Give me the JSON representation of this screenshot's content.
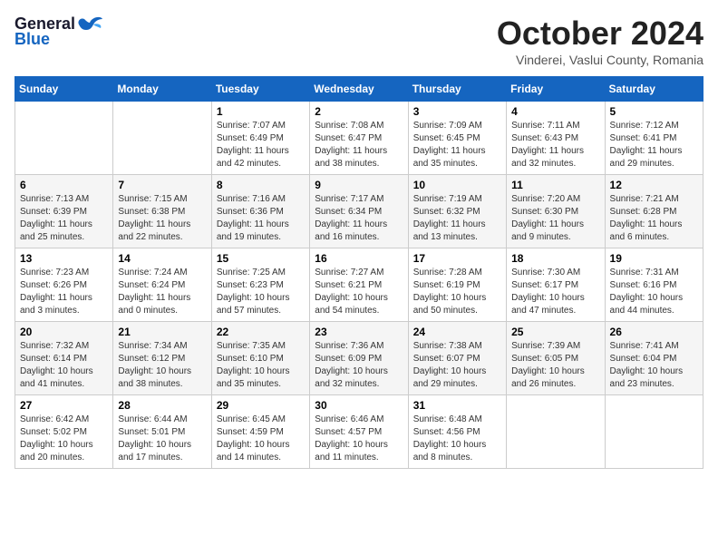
{
  "logo": {
    "general": "General",
    "blue": "Blue"
  },
  "title": "October 2024",
  "subtitle": "Vinderei, Vaslui County, Romania",
  "days_of_week": [
    "Sunday",
    "Monday",
    "Tuesday",
    "Wednesday",
    "Thursday",
    "Friday",
    "Saturday"
  ],
  "weeks": [
    [
      {
        "day": "",
        "info": ""
      },
      {
        "day": "",
        "info": ""
      },
      {
        "day": "1",
        "sunrise": "Sunrise: 7:07 AM",
        "sunset": "Sunset: 6:49 PM",
        "daylight": "Daylight: 11 hours and 42 minutes."
      },
      {
        "day": "2",
        "sunrise": "Sunrise: 7:08 AM",
        "sunset": "Sunset: 6:47 PM",
        "daylight": "Daylight: 11 hours and 38 minutes."
      },
      {
        "day": "3",
        "sunrise": "Sunrise: 7:09 AM",
        "sunset": "Sunset: 6:45 PM",
        "daylight": "Daylight: 11 hours and 35 minutes."
      },
      {
        "day": "4",
        "sunrise": "Sunrise: 7:11 AM",
        "sunset": "Sunset: 6:43 PM",
        "daylight": "Daylight: 11 hours and 32 minutes."
      },
      {
        "day": "5",
        "sunrise": "Sunrise: 7:12 AM",
        "sunset": "Sunset: 6:41 PM",
        "daylight": "Daylight: 11 hours and 29 minutes."
      }
    ],
    [
      {
        "day": "6",
        "sunrise": "Sunrise: 7:13 AM",
        "sunset": "Sunset: 6:39 PM",
        "daylight": "Daylight: 11 hours and 25 minutes."
      },
      {
        "day": "7",
        "sunrise": "Sunrise: 7:15 AM",
        "sunset": "Sunset: 6:38 PM",
        "daylight": "Daylight: 11 hours and 22 minutes."
      },
      {
        "day": "8",
        "sunrise": "Sunrise: 7:16 AM",
        "sunset": "Sunset: 6:36 PM",
        "daylight": "Daylight: 11 hours and 19 minutes."
      },
      {
        "day": "9",
        "sunrise": "Sunrise: 7:17 AM",
        "sunset": "Sunset: 6:34 PM",
        "daylight": "Daylight: 11 hours and 16 minutes."
      },
      {
        "day": "10",
        "sunrise": "Sunrise: 7:19 AM",
        "sunset": "Sunset: 6:32 PM",
        "daylight": "Daylight: 11 hours and 13 minutes."
      },
      {
        "day": "11",
        "sunrise": "Sunrise: 7:20 AM",
        "sunset": "Sunset: 6:30 PM",
        "daylight": "Daylight: 11 hours and 9 minutes."
      },
      {
        "day": "12",
        "sunrise": "Sunrise: 7:21 AM",
        "sunset": "Sunset: 6:28 PM",
        "daylight": "Daylight: 11 hours and 6 minutes."
      }
    ],
    [
      {
        "day": "13",
        "sunrise": "Sunrise: 7:23 AM",
        "sunset": "Sunset: 6:26 PM",
        "daylight": "Daylight: 11 hours and 3 minutes."
      },
      {
        "day": "14",
        "sunrise": "Sunrise: 7:24 AM",
        "sunset": "Sunset: 6:24 PM",
        "daylight": "Daylight: 11 hours and 0 minutes."
      },
      {
        "day": "15",
        "sunrise": "Sunrise: 7:25 AM",
        "sunset": "Sunset: 6:23 PM",
        "daylight": "Daylight: 10 hours and 57 minutes."
      },
      {
        "day": "16",
        "sunrise": "Sunrise: 7:27 AM",
        "sunset": "Sunset: 6:21 PM",
        "daylight": "Daylight: 10 hours and 54 minutes."
      },
      {
        "day": "17",
        "sunrise": "Sunrise: 7:28 AM",
        "sunset": "Sunset: 6:19 PM",
        "daylight": "Daylight: 10 hours and 50 minutes."
      },
      {
        "day": "18",
        "sunrise": "Sunrise: 7:30 AM",
        "sunset": "Sunset: 6:17 PM",
        "daylight": "Daylight: 10 hours and 47 minutes."
      },
      {
        "day": "19",
        "sunrise": "Sunrise: 7:31 AM",
        "sunset": "Sunset: 6:16 PM",
        "daylight": "Daylight: 10 hours and 44 minutes."
      }
    ],
    [
      {
        "day": "20",
        "sunrise": "Sunrise: 7:32 AM",
        "sunset": "Sunset: 6:14 PM",
        "daylight": "Daylight: 10 hours and 41 minutes."
      },
      {
        "day": "21",
        "sunrise": "Sunrise: 7:34 AM",
        "sunset": "Sunset: 6:12 PM",
        "daylight": "Daylight: 10 hours and 38 minutes."
      },
      {
        "day": "22",
        "sunrise": "Sunrise: 7:35 AM",
        "sunset": "Sunset: 6:10 PM",
        "daylight": "Daylight: 10 hours and 35 minutes."
      },
      {
        "day": "23",
        "sunrise": "Sunrise: 7:36 AM",
        "sunset": "Sunset: 6:09 PM",
        "daylight": "Daylight: 10 hours and 32 minutes."
      },
      {
        "day": "24",
        "sunrise": "Sunrise: 7:38 AM",
        "sunset": "Sunset: 6:07 PM",
        "daylight": "Daylight: 10 hours and 29 minutes."
      },
      {
        "day": "25",
        "sunrise": "Sunrise: 7:39 AM",
        "sunset": "Sunset: 6:05 PM",
        "daylight": "Daylight: 10 hours and 26 minutes."
      },
      {
        "day": "26",
        "sunrise": "Sunrise: 7:41 AM",
        "sunset": "Sunset: 6:04 PM",
        "daylight": "Daylight: 10 hours and 23 minutes."
      }
    ],
    [
      {
        "day": "27",
        "sunrise": "Sunrise: 6:42 AM",
        "sunset": "Sunset: 5:02 PM",
        "daylight": "Daylight: 10 hours and 20 minutes."
      },
      {
        "day": "28",
        "sunrise": "Sunrise: 6:44 AM",
        "sunset": "Sunset: 5:01 PM",
        "daylight": "Daylight: 10 hours and 17 minutes."
      },
      {
        "day": "29",
        "sunrise": "Sunrise: 6:45 AM",
        "sunset": "Sunset: 4:59 PM",
        "daylight": "Daylight: 10 hours and 14 minutes."
      },
      {
        "day": "30",
        "sunrise": "Sunrise: 6:46 AM",
        "sunset": "Sunset: 4:57 PM",
        "daylight": "Daylight: 10 hours and 11 minutes."
      },
      {
        "day": "31",
        "sunrise": "Sunrise: 6:48 AM",
        "sunset": "Sunset: 4:56 PM",
        "daylight": "Daylight: 10 hours and 8 minutes."
      },
      {
        "day": "",
        "info": ""
      },
      {
        "day": "",
        "info": ""
      }
    ]
  ]
}
